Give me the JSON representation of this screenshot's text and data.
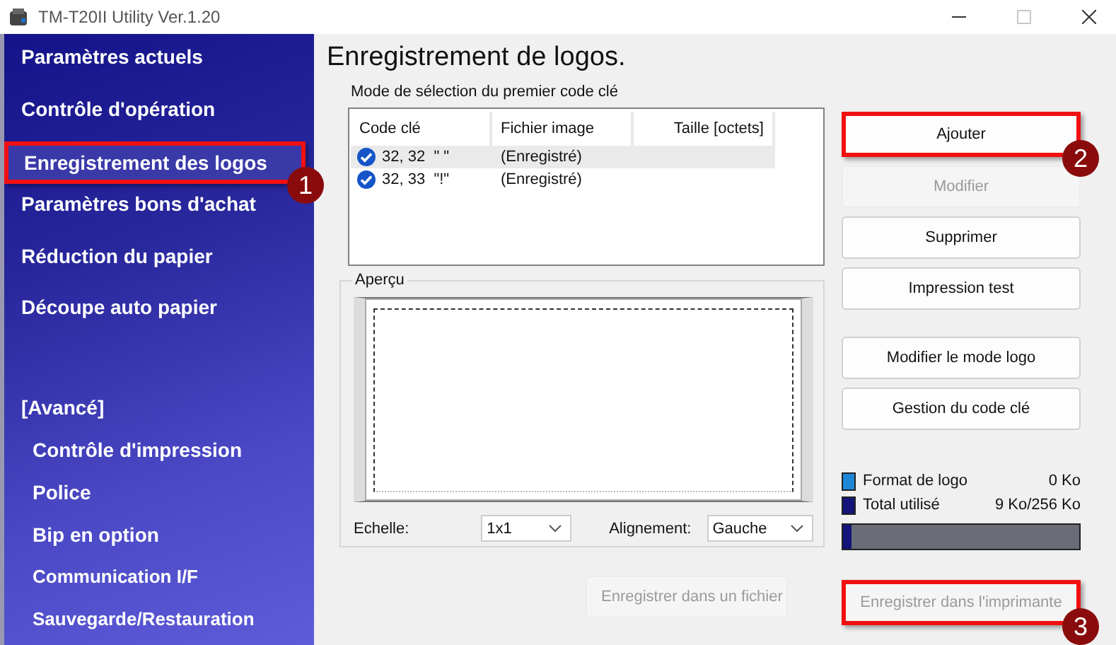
{
  "window": {
    "title": "TM-T20II Utility Ver.1.20"
  },
  "sidebar": {
    "items": [
      {
        "label": "Paramètres actuels",
        "kind": "main",
        "selected": false
      },
      {
        "label": "Contrôle d'opération",
        "kind": "main",
        "selected": false
      },
      {
        "label": "Enregistrement des logos",
        "kind": "main",
        "selected": true,
        "callout": "1"
      },
      {
        "label": "Paramètres bons d'achat",
        "kind": "main",
        "selected": false
      },
      {
        "label": "Réduction du papier",
        "kind": "main",
        "selected": false
      },
      {
        "label": "Découpe auto papier",
        "kind": "main",
        "selected": false
      },
      {
        "label": "[Avancé]",
        "kind": "header"
      },
      {
        "label": "Contrôle d'impression",
        "kind": "sub",
        "selected": false
      },
      {
        "label": "Police",
        "kind": "sub",
        "selected": false
      },
      {
        "label": "Bip en option",
        "kind": "sub",
        "selected": false
      },
      {
        "label": "Communication I/F",
        "kind": "sub-small",
        "selected": false
      },
      {
        "label": "Sauvegarde/Restauration",
        "kind": "sub-small",
        "selected": false
      }
    ]
  },
  "page_title": "Enregistrement de logos.",
  "key_mode_label": "Mode de sélection du premier code clé",
  "logo_table": {
    "columns": [
      "Code clé",
      "Fichier image",
      "Taille [octets]"
    ],
    "rows": [
      {
        "cells": [
          "32, 32  \" \"",
          "(Enregistré)",
          ""
        ],
        "checked": true,
        "selected": true
      },
      {
        "cells": [
          "32, 33  \"!\"",
          "(Enregistré)",
          ""
        ],
        "checked": true,
        "selected": false
      }
    ]
  },
  "preview": {
    "title": "Aperçu",
    "scale_label": "Echelle:",
    "scale_value": "1x1",
    "align_label": "Alignement:",
    "align_value": "Gauche"
  },
  "buttons": [
    {
      "label": "Ajouter",
      "disabled": false,
      "callout": "2"
    },
    {
      "label": "Modifier",
      "disabled": true
    },
    {
      "label": "Supprimer",
      "disabled": false
    },
    {
      "label": "Impression test",
      "disabled": false
    }
  ],
  "logo_buttons": [
    {
      "label": "Modifier le mode logo",
      "disabled": false
    },
    {
      "label": "Gestion du code clé",
      "disabled": false
    }
  ],
  "memory": {
    "legend": [
      {
        "label": "Format de logo",
        "value": "0 Ko",
        "color": "#1e88d8"
      },
      {
        "label": "Total utilisé",
        "value": "9 Ko/256 Ko",
        "color": "#14147a"
      }
    ],
    "level": 0.035
  },
  "save_file_button": {
    "label": "Enregistrer dans un fichier",
    "disabled": true
  },
  "save_printer_button": {
    "label": "Enregistrer dans l'imprimante",
    "disabled": true,
    "callout": "3"
  }
}
